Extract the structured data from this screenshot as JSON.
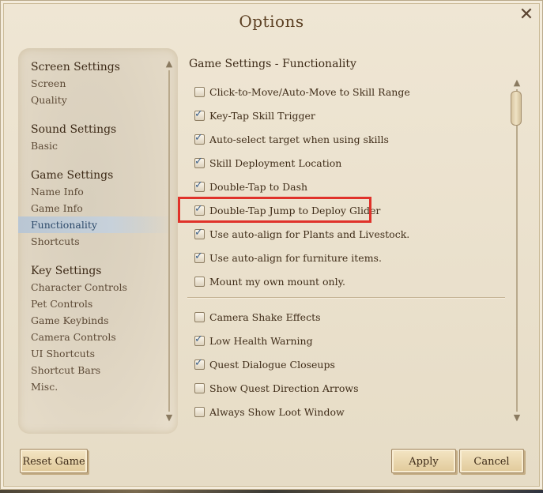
{
  "window": {
    "title": "Options",
    "close_glyph": "✕"
  },
  "sidebar": {
    "sections": [
      {
        "heading": "Screen Settings",
        "items": [
          "Screen",
          "Quality"
        ]
      },
      {
        "heading": "Sound Settings",
        "items": [
          "Basic"
        ]
      },
      {
        "heading": "Game Settings",
        "items": [
          "Name Info",
          "Game Info",
          "Functionality",
          "Shortcuts"
        ]
      },
      {
        "heading": "Key Settings",
        "items": [
          "Character Controls",
          "Pet Controls",
          "Game Keybinds",
          "Camera Controls",
          "UI Shortcuts",
          "Shortcut Bars",
          "Misc."
        ]
      }
    ],
    "active_item": "Functionality"
  },
  "main": {
    "heading": "Game Settings - Functionality",
    "group1": [
      {
        "label": "Click-to-Move/Auto-Move to Skill Range",
        "checked": false
      },
      {
        "label": "Key-Tap Skill Trigger",
        "checked": true
      },
      {
        "label": "Auto-select target when using skills",
        "checked": true
      },
      {
        "label": "Skill Deployment Location",
        "checked": true
      },
      {
        "label": "Double-Tap to Dash",
        "checked": true
      },
      {
        "label": "Double-Tap Jump to Deploy Glider",
        "checked": true
      },
      {
        "label": "Use auto-align for Plants and Livestock.",
        "checked": true
      },
      {
        "label": "Use auto-align for furniture items.",
        "checked": true
      },
      {
        "label": "Mount my own mount only.",
        "checked": false
      }
    ],
    "group2": [
      {
        "label": "Camera Shake Effects",
        "checked": false
      },
      {
        "label": "Low Health Warning",
        "checked": true
      },
      {
        "label": "Quest Dialogue Closeups",
        "checked": true
      },
      {
        "label": "Show Quest Direction Arrows",
        "checked": false
      },
      {
        "label": "Always Show Loot Window",
        "checked": false
      }
    ]
  },
  "buttons": {
    "reset": "Reset Game",
    "apply": "Apply",
    "cancel": "Cancel"
  },
  "glyphs": {
    "check": "✓",
    "arrow_up": "▲",
    "arrow_down": "▼"
  },
  "colors": {
    "highlight_border": "#e0322a",
    "active_item_text": "#2d4a6a",
    "check": "#3f628a"
  }
}
